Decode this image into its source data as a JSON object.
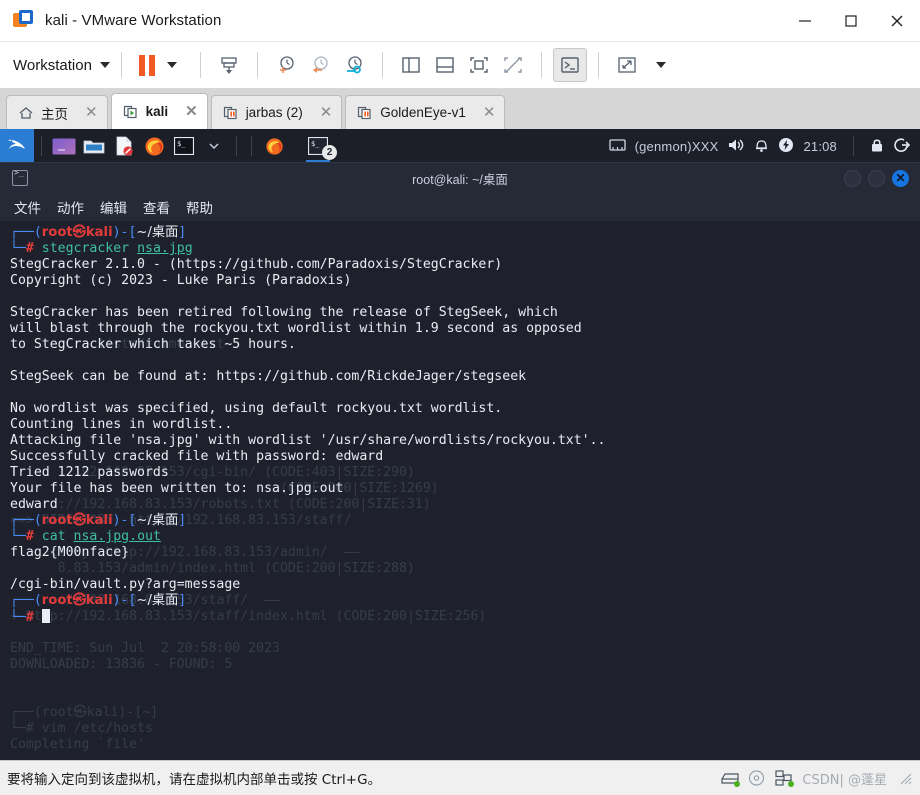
{
  "window": {
    "title": "kali - VMware Workstation",
    "app_icon": "vmware-logo-icon",
    "minimize": "—",
    "maximize": "□",
    "close": "✕"
  },
  "toolbar": {
    "workstation_label": "Workstation",
    "items": [
      {
        "name": "pause-button",
        "label": "Pause"
      },
      {
        "name": "send-ctrl-alt-del-button",
        "label": "Send Ctrl+Alt+Del"
      },
      {
        "name": "take-snapshot-button",
        "label": "Take snapshot"
      },
      {
        "name": "revert-snapshot-button",
        "label": "Revert to snapshot"
      },
      {
        "name": "manage-snapshots-button",
        "label": "Manage snapshots"
      },
      {
        "name": "show-library-button",
        "label": "Show or hide library"
      },
      {
        "name": "show-thumbnail-bar-button",
        "label": "Show or hide thumbnail bar"
      },
      {
        "name": "show-console-view-button",
        "label": "Console view"
      },
      {
        "name": "hide-console-view-button",
        "label": "Hide console view"
      },
      {
        "name": "full-screen-button",
        "label": "Enter full screen"
      },
      {
        "name": "unity-mode-button",
        "label": "Unity mode"
      }
    ]
  },
  "tabs": [
    {
      "label": "主页",
      "icon": "home-icon",
      "active": false,
      "close": "✕"
    },
    {
      "label": "kali",
      "icon": "vm-running-icon",
      "active": true,
      "close": "✕"
    },
    {
      "label": "jarbas (2)",
      "icon": "vm-suspended-icon",
      "active": false,
      "close": "✕"
    },
    {
      "label": "GoldenEye-v1",
      "icon": "vm-suspended-icon",
      "active": false,
      "close": "✕"
    }
  ],
  "kali_panel": {
    "logo": "kali-dragon-logo",
    "launchers": [
      {
        "name": "launcher-terminal-purple",
        "icon": "terminal-purple-icon"
      },
      {
        "name": "launcher-file-manager",
        "icon": "folder-icon"
      },
      {
        "name": "launcher-text-editor",
        "icon": "document-blocked-icon"
      },
      {
        "name": "launcher-firefox",
        "icon": "firefox-icon"
      },
      {
        "name": "launcher-terminal",
        "icon": "terminal-icon"
      },
      {
        "name": "launcher-dropdown",
        "icon": "chevron-down-icon"
      }
    ],
    "tasks": [
      {
        "name": "task-firefox",
        "icon": "firefox-icon",
        "badge": "",
        "active": false
      },
      {
        "name": "task-terminal",
        "icon": "terminal-icon",
        "badge": "2",
        "active": true
      }
    ],
    "tray": {
      "network_icon": "network-icon",
      "genmon_text": "(genmon)XXX",
      "volume_icon": "volume-icon",
      "notification_icon": "bell-icon",
      "power_icon": "power-icon",
      "clock": "21:08",
      "lock_icon": "lock-icon",
      "logout_icon": "logout-icon"
    }
  },
  "terminal": {
    "title": "root@kali: ~/桌面",
    "titlebar_icon": "terminal-icon",
    "window_buttons": {
      "minimize": "",
      "maximize": "",
      "close": "✕"
    },
    "menu": [
      "文件",
      "动作",
      "编辑",
      "查看",
      "帮助"
    ],
    "prompt": {
      "top_branch": "┌──(",
      "user_host": "root㉿kali",
      "close_paren": ")-[",
      "path": "~/桌面",
      "close_bracket": "]",
      "bottom_branch": "└─",
      "hash": "#"
    },
    "lines": [
      {
        "type": "prompt"
      },
      {
        "type": "command",
        "cmd": "stegcracker",
        "arg": "nsa.jpg"
      },
      {
        "type": "out",
        "text": "StegCracker 2.1.0 - (https://github.com/Paradoxis/StegCracker)"
      },
      {
        "type": "out",
        "text": "Copyright (c) 2023 - Luke Paris (Paradoxis)"
      },
      {
        "type": "out",
        "text": ""
      },
      {
        "type": "out",
        "text": "StegCracker has been retired following the release of StegSeek, which"
      },
      {
        "type": "out",
        "text": "will blast through the rockyou.txt wordlist within 1.9 second as opposed"
      },
      {
        "type": "out",
        "text": "to StegCracker which takes ~5 hours."
      },
      {
        "type": "out",
        "text": ""
      },
      {
        "type": "out",
        "text": "StegSeek can be found at: https://github.com/RickdeJager/stegseek"
      },
      {
        "type": "out",
        "text": ""
      },
      {
        "type": "out",
        "text": "No wordlist was specified, using default rockyou.txt wordlist."
      },
      {
        "type": "out",
        "text": "Counting lines in wordlist.."
      },
      {
        "type": "out",
        "text": "Attacking file 'nsa.jpg' with wordlist '/usr/share/wordlists/rockyou.txt'.."
      },
      {
        "type": "out",
        "text": "Successfully cracked file with password: edward"
      },
      {
        "type": "out",
        "text": "Tried 1212 passwords"
      },
      {
        "type": "out",
        "text": "Your file has been written to: nsa.jpg.out"
      },
      {
        "type": "out",
        "text": "edward"
      },
      {
        "type": "prompt"
      },
      {
        "type": "command",
        "cmd": "cat",
        "arg": "nsa.jpg.out"
      },
      {
        "type": "out",
        "text": "flag2{M00nface}"
      },
      {
        "type": "out",
        "text": ""
      },
      {
        "type": "out",
        "text": "/cgi-bin/vault.py?arg=message"
      },
      {
        "type": "prompt"
      },
      {
        "type": "cursor"
      }
    ],
    "ghost_lines": [
      "",
      "",
      "",
      "",
      "",
      "",
      "",
      "           lists/common.txt",
      "",
      "",
      "",
      "",
      "",
      "",
      "",
      "        192.168.83.153/cgi-bin/ (CODE:403|SIZE:290)",
      "                                  (CODE:200|SIZE:1269)",
      "      ://192.168.83.153/robots.txt (CODE:200|SIZE:31)",
      "==> DIRECTORY: http://192.168.83.153/staff/",
      "",
      "     ctory: http://192.168.83.153/admin/  ——",
      "      8.83.153/admin/index.html (CODE:200|SIZE:288)",
      "",
      "      .//192.168.83.153/staff/  ——",
      "+ http://192.168.83.153/staff/index.html (CODE:200|SIZE:256)",
      "",
      "END_TIME: Sun Jul  2 20:58:00 2023",
      "DOWNLOADED: 13836 - FOUND: 5",
      "",
      "",
      "┌──(root㉿kali)-[~]",
      "└─# vim /etc/hosts",
      "Completing `file'"
    ]
  },
  "statusbar": {
    "message": "要将输入定向到该虚拟机，请在虚拟机内部单击或按 Ctrl+G。",
    "icons": [
      {
        "name": "hard-disk-status-icon"
      },
      {
        "name": "cd-dvd-status-icon"
      },
      {
        "name": "network-adapter-status-icon"
      }
    ],
    "watermark": "CSDN| @蓬星"
  },
  "colors": {
    "accent_blue": "#1474e0",
    "orange": "#f15a22",
    "terminal_bg": "#1e212b",
    "prompt_red": "#e23b3b",
    "prompt_blue": "#4a8df8",
    "command_teal": "#3fbfa6"
  }
}
